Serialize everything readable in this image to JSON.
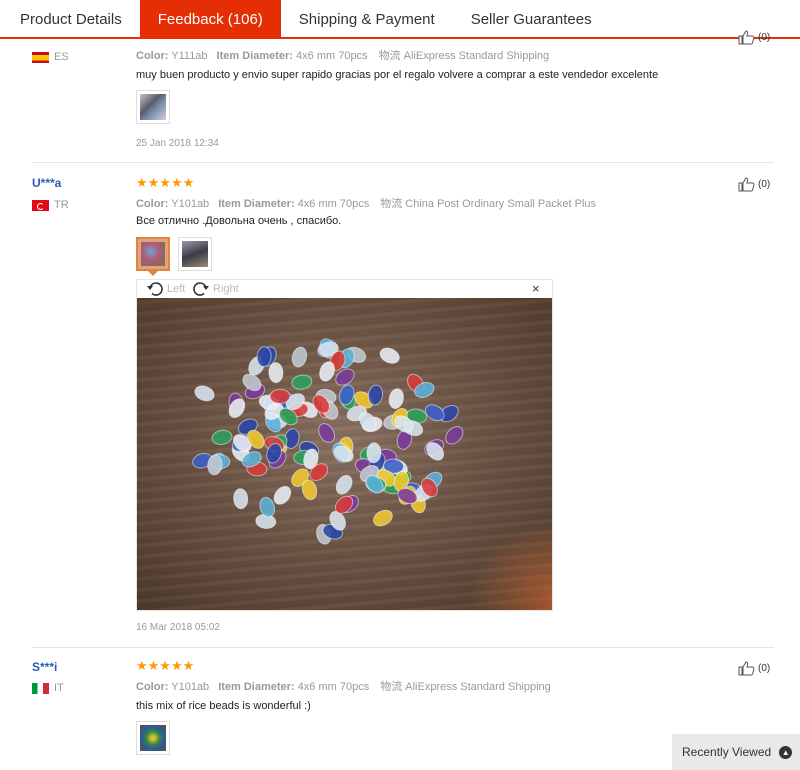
{
  "tabs": [
    {
      "label": "Product Details"
    },
    {
      "label": "Feedback (106)"
    },
    {
      "label": "Shipping & Payment"
    },
    {
      "label": "Seller Guarantees"
    }
  ],
  "attr_labels": {
    "color": "Color:",
    "diameter": "Item Diameter:",
    "ship_icon": "物流"
  },
  "reviews": [
    {
      "country": "ES",
      "color": "Y111ab",
      "diameter": "4x6 mm 70pcs",
      "shipping": "AliExpress Standard Shipping",
      "text": "muy buen producto y envio super rapido gracias por el regalo volvere a comprar a este vendedor excelente",
      "date": "25 Jan 2018 12:34",
      "likes": "(0)"
    },
    {
      "user": "U***a",
      "country": "TR",
      "stars": "★★★★★",
      "color": "Y101ab",
      "diameter": "4x6 mm 70pcs",
      "shipping": "China Post Ordinary Small Packet Plus",
      "text": "Все отлично .Довольна очень , спасибо.",
      "date": "16 Mar 2018 05:02",
      "likes": "(0)"
    },
    {
      "user": "S***i",
      "country": "IT",
      "stars": "★★★★★",
      "color": "Y101ab",
      "diameter": "4x6 mm 70pcs",
      "shipping": "AliExpress Standard Shipping",
      "text": "this mix of rice beads is wonderful :)",
      "likes": "(0)"
    }
  ],
  "viewer": {
    "rotate_left": "Left",
    "rotate_right": "Right",
    "close": "×"
  },
  "recently_viewed": "Recently Viewed",
  "colors": {
    "accent": "#e62e04",
    "star": "#ff9900",
    "user_link": "#2a5db0"
  }
}
